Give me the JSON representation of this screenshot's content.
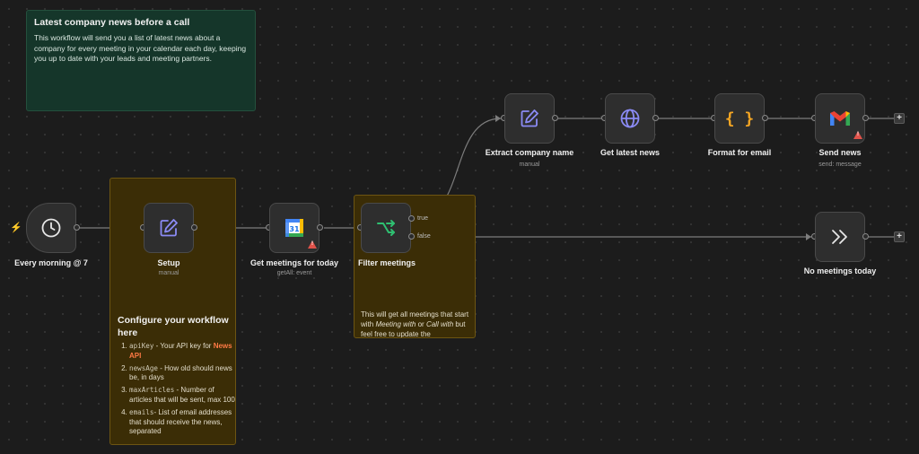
{
  "notes": {
    "intro": {
      "title": "Latest company news before a call",
      "body": "This workflow will send you a list of latest news about a company for every meeting in your calendar each day, keeping you up to date with your leads and meeting partners."
    },
    "config": {
      "title": "Configure your workflow here",
      "items": [
        {
          "code": "apiKey",
          "text": " - Your API key for ",
          "link": "News API"
        },
        {
          "code": "newsAge",
          "text": " - How old should news be, in days"
        },
        {
          "code": "maxArticles",
          "text": " - Number of articles that will be sent, max 100"
        },
        {
          "code": "emails",
          "text": "- List of email addresses that should receive the news, separated"
        }
      ]
    },
    "filter": {
      "body_1": "This will get all meetings that start with ",
      "em_1": "Meeting with",
      "body_2": " or ",
      "em_2": "Call with",
      "body_3": " but feel free to update the"
    }
  },
  "nodes": {
    "trigger": {
      "label": "Every morning @ 7",
      "icon": "clock-icon"
    },
    "setup": {
      "label": "Setup",
      "sub": "manual",
      "icon": "edit-icon"
    },
    "get_meetings": {
      "label": "Get meetings for today",
      "sub": "getAll: event",
      "icon": "google-calendar-icon",
      "calendar_day": "31"
    },
    "filter": {
      "label": "Filter meetings",
      "icon": "if-branch-icon",
      "true_label": "true",
      "false_label": "false"
    },
    "extract": {
      "label": "Extract company name",
      "sub": "manual",
      "icon": "edit-icon"
    },
    "get_news": {
      "label": "Get latest news",
      "icon": "globe-icon"
    },
    "format": {
      "label": "Format for email",
      "icon": "braces-icon",
      "glyph": "{ }"
    },
    "send": {
      "label": "Send news",
      "sub": "send: message",
      "icon": "gmail-icon"
    },
    "no_meetings": {
      "label": "No meetings today",
      "icon": "double-chevron-right-icon"
    }
  },
  "controls": {
    "add": "+"
  },
  "colors": {
    "canvas": "#1c1c1c",
    "node": "#2e2e2e",
    "edge": "#7d7d7d",
    "sticky_green": "#15362a",
    "sticky_amber": "#3b2d06",
    "icon_purple": "#8b8bf5",
    "icon_orange": "#f5a623",
    "icon_green": "#2fbf71",
    "warning": "#e0524a"
  }
}
